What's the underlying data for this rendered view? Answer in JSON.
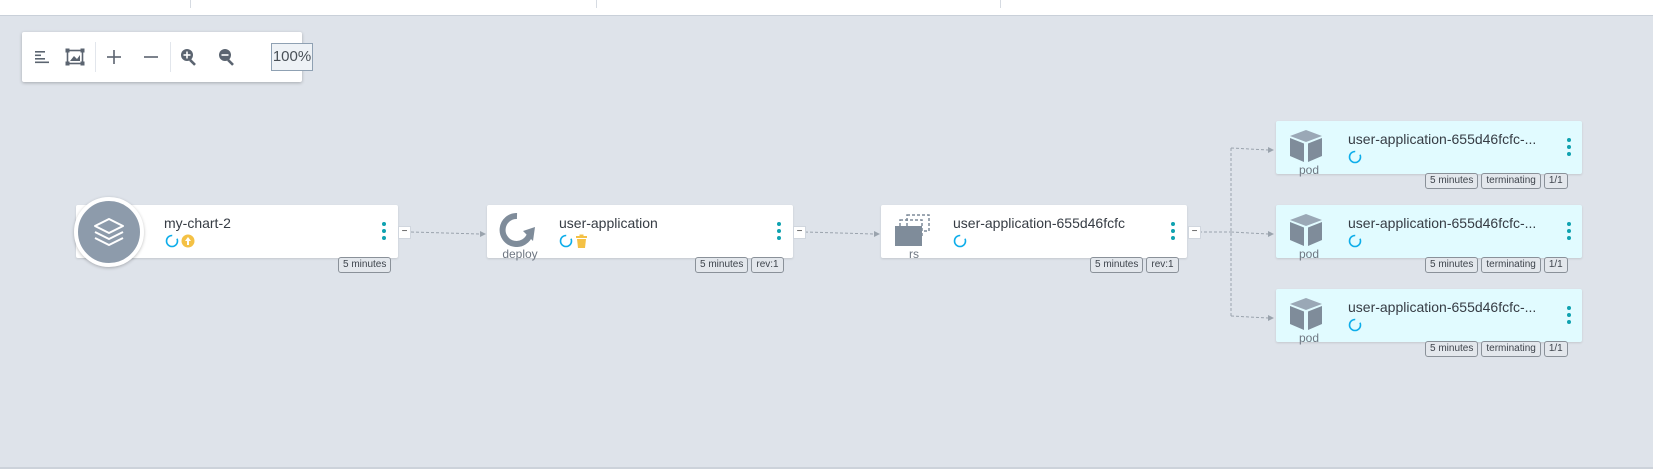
{
  "toolbar": {
    "buttons": [
      "align-left-icon",
      "fit-to-screen-icon",
      "plus-icon",
      "minus-icon",
      "zoom-in-icon",
      "zoom-out-icon"
    ],
    "zoom_level": "100%"
  },
  "nodes": {
    "chart": {
      "title": "my-chart-2",
      "kind": "",
      "age": "5 minutes"
    },
    "deploy": {
      "title": "user-application",
      "kind": "deploy",
      "age": "5 minutes",
      "rev": "rev:1"
    },
    "rs": {
      "title": "user-application-655d46fcfc",
      "kind": "rs",
      "age": "5 minutes",
      "rev": "rev:1"
    },
    "pods": [
      {
        "title": "user-application-655d46fcfc-...",
        "kind": "pod",
        "age": "5 minutes",
        "status": "terminating",
        "ready": "1/1"
      },
      {
        "title": "user-application-655d46fcfc-...",
        "kind": "pod",
        "age": "5 minutes",
        "status": "terminating",
        "ready": "1/1"
      },
      {
        "title": "user-application-655d46fcfc-...",
        "kind": "pod",
        "age": "5 minutes",
        "status": "terminating",
        "ready": "1/1"
      }
    ]
  },
  "colors": {
    "background": "#dee3ea",
    "accent": "#0fa2b0",
    "progressing": "#0dadea",
    "warning": "#f4c145",
    "pod_bg": "#e1fbff",
    "icon_gray": "#8d9bab"
  },
  "collapse_symbol": "−"
}
